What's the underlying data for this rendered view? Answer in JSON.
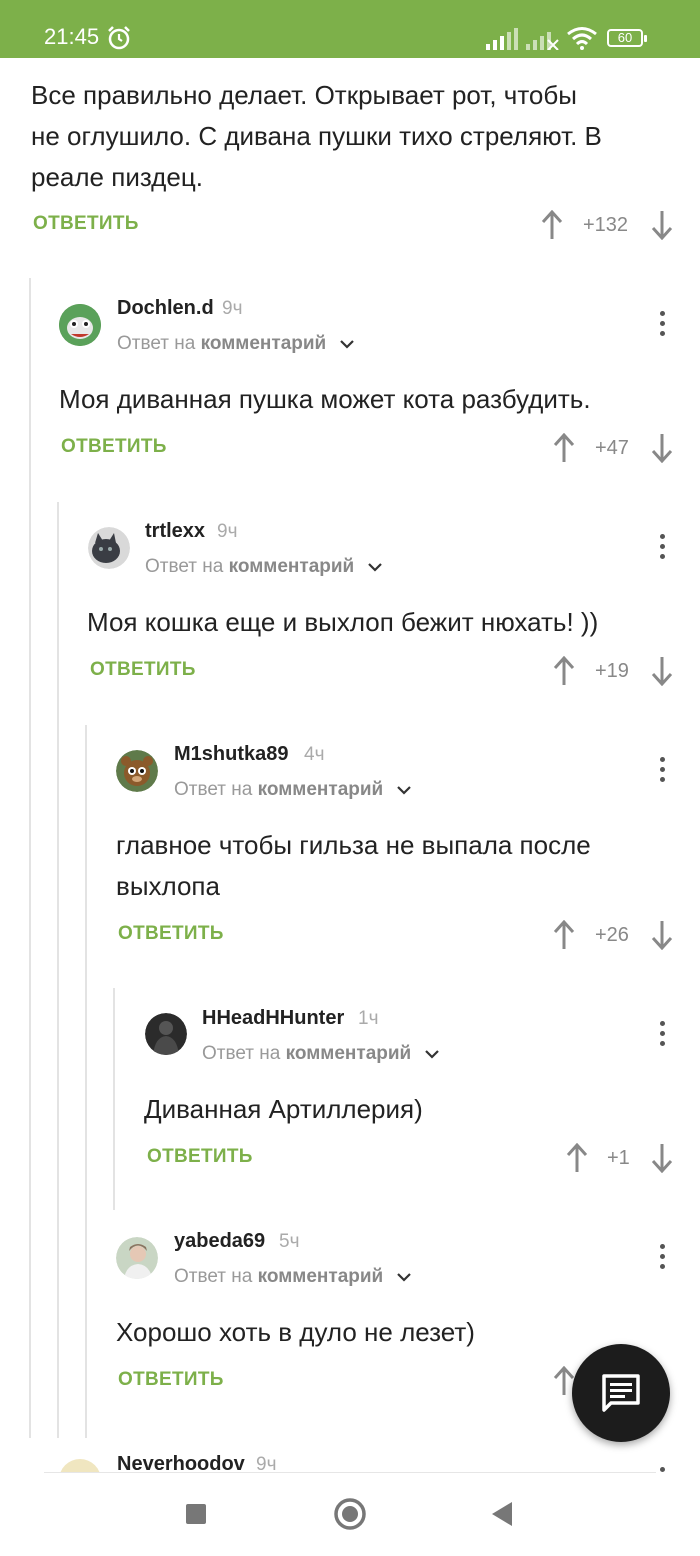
{
  "status_bar": {
    "time": "21:45",
    "battery": "60"
  },
  "colors": {
    "brand_green": "#7db04a",
    "text": "#222222",
    "muted": "#999999",
    "fab": "#1c1c1c"
  },
  "top_comment": {
    "text_lines": [
      "Все правильно делает. Открывает рот, чтобы",
      "не оглушило. С дивана пушки тихо стреляют. В",
      "реале пиздец."
    ],
    "reply_label": "ОТВЕТИТЬ",
    "score": "+132"
  },
  "comments": [
    {
      "username": "Dochlen.d",
      "time": "9ч",
      "reply_prefix": "Ответ на",
      "reply_target": "комментарий",
      "text_lines": [
        "Моя диванная пушка может кота разбудить."
      ],
      "reply_label": "ОТВЕТИТЬ",
      "score": "+47"
    },
    {
      "username": "trtlexx",
      "time": "9ч",
      "reply_prefix": "Ответ на",
      "reply_target": "комментарий",
      "text_lines": [
        "Моя кошка еще и выхлоп бежит нюхать! ))"
      ],
      "reply_label": "ОТВЕТИТЬ",
      "score": "+19"
    },
    {
      "username": "M1shutka89",
      "time": "4ч",
      "reply_prefix": "Ответ на",
      "reply_target": "комментарий",
      "text_lines": [
        "главное чтобы гильза не выпала после",
        "выхлопа"
      ],
      "reply_label": "ОТВЕТИТЬ",
      "score": "+26"
    },
    {
      "username": "HHeadHHunter",
      "time": "1ч",
      "reply_prefix": "Ответ на",
      "reply_target": "комментарий",
      "text_lines": [
        "Диванная Артиллерия)"
      ],
      "reply_label": "ОТВЕТИТЬ",
      "score": "+1"
    },
    {
      "username": "yabeda69",
      "time": "5ч",
      "reply_prefix": "Ответ на",
      "reply_target": "комментарий",
      "text_lines": [
        "Хорошо хоть в дуло не лезет)"
      ],
      "reply_label": "ОТВЕТИТЬ",
      "score": ""
    },
    {
      "username": "Neverhoodov",
      "time": "9ч"
    }
  ],
  "icons": {
    "alarm": "alarm-clock-icon",
    "signal": "signal-bars-icon",
    "wifi": "wifi-icon",
    "battery": "battery-icon",
    "upvote": "arrow-up-icon",
    "downvote": "arrow-down-icon",
    "more": "kebab-menu-icon",
    "fab": "comment-icon",
    "nav": [
      "square-recents-icon",
      "circle-home-icon",
      "triangle-back-icon"
    ]
  }
}
